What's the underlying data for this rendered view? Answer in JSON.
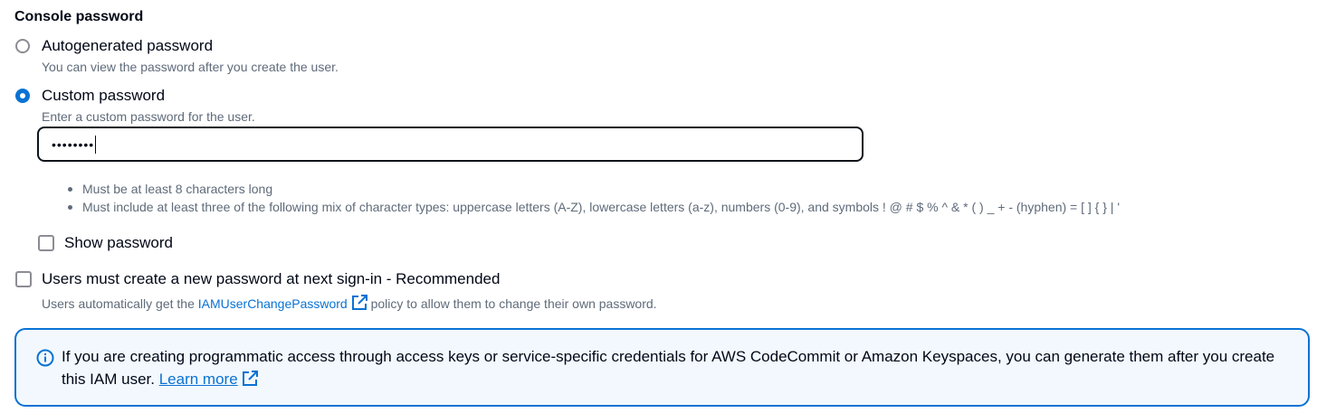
{
  "section": {
    "title": "Console password"
  },
  "options": {
    "autogenerated": {
      "label": "Autogenerated password",
      "description": "You can view the password after you create the user.",
      "selected": false
    },
    "custom": {
      "label": "Custom password",
      "description": "Enter a custom password for the user.",
      "selected": true
    }
  },
  "password_input": {
    "value": "••••••••"
  },
  "requirements": [
    "Must be at least 8 characters long",
    "Must include at least three of the following mix of character types: uppercase letters (A-Z), lowercase letters (a-z), numbers (0-9), and symbols ! @ # $ % ^ & * ( ) _ + - (hyphen) = [ ] { } | '"
  ],
  "show_password": {
    "label": "Show password",
    "checked": false
  },
  "require_reset": {
    "label": "Users must create a new password at next sign-in - Recommended",
    "checked": false,
    "desc_before": "Users automatically get the",
    "link_text": "IAMUserChangePassword",
    "desc_after": "policy to allow them to change their own password."
  },
  "info": {
    "text": "If you are creating programmatic access through access keys or service-specific credentials for AWS CodeCommit or Amazon Keyspaces, you can generate them after you create this IAM user.",
    "learn_more": "Learn more"
  },
  "colors": {
    "accent": "#0972d3",
    "info_bg": "#f2f8fd",
    "muted_text": "#5f6b7a"
  }
}
